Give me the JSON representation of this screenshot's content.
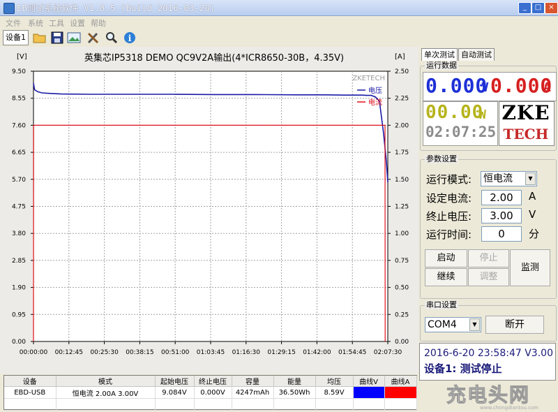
{
  "window": {
    "title": "EB测试系统软件 V1.8.5 (Build 2016-03-20)",
    "minimize": "_",
    "maximize": "□",
    "close": "×"
  },
  "menu": [
    "文件",
    "系统",
    "工具",
    "设置",
    "帮助"
  ],
  "toolbar": {
    "device_tab": "设备1",
    "icons": [
      "folder-open-icon",
      "save-icon",
      "picture-icon",
      "tools-icon",
      "zoom-icon",
      "info-icon"
    ]
  },
  "chart_data": {
    "type": "line",
    "title": "英集芯IP5318 DEMO QC9V2A输出(4*ICR8650-30B，4.35V)",
    "watermark": "ZKETECH",
    "y_left_unit": "[V]",
    "y_right_unit": "[A]",
    "ylim_left": [
      0,
      9.5
    ],
    "ylim_right": [
      0,
      2.5
    ],
    "y_left_ticks": [
      "9.50",
      "8.55",
      "7.60",
      "6.65",
      "5.70",
      "4.75",
      "3.80",
      "2.85",
      "1.90",
      "0.95",
      "0.00"
    ],
    "y_right_ticks": [
      "2.50",
      "2.25",
      "2.00",
      "1.75",
      "1.50",
      "1.25",
      "1.00",
      "0.75",
      "0.50",
      "0.25",
      "0.00"
    ],
    "x_ticks": [
      "00:00:00",
      "00:12:45",
      "00:25:30",
      "00:38:15",
      "00:51:00",
      "01:03:45",
      "01:16:30",
      "01:29:15",
      "01:42:00",
      "01:54:45",
      "02:07:30"
    ],
    "grid": true,
    "legend_position": "top-right",
    "series": [
      {
        "name": "电压",
        "axis": "left",
        "color": "#1a1aa6",
        "x_minutes": [
          0,
          0.4,
          1.5,
          3,
          6,
          10,
          20,
          35,
          50,
          65,
          80,
          95,
          105,
          112,
          118,
          120,
          121.5,
          123,
          124.5,
          126,
          127,
          127.5
        ],
        "values": [
          9.08,
          8.85,
          8.78,
          8.74,
          8.72,
          8.7,
          8.69,
          8.69,
          8.69,
          8.68,
          8.68,
          8.67,
          8.67,
          8.66,
          8.66,
          8.65,
          8.65,
          8.6,
          8.45,
          7.3,
          6.3,
          5.6
        ]
      },
      {
        "name": "电流",
        "axis": "right",
        "color": "#e0101a",
        "x_minutes": [
          0,
          0.05,
          126.5,
          126.55
        ],
        "values": [
          0,
          2.0,
          2.0,
          0
        ]
      }
    ]
  },
  "right_panel": {
    "tabs": [
      "单次测试",
      "自动测试"
    ],
    "run_data_label": "运行数据",
    "voltage": "0.000",
    "voltage_unit": "V",
    "current": "0.000",
    "current_unit": "A",
    "power": "00.00",
    "power_unit": "W",
    "time": "02:07:25",
    "logo_line1": "ZKE",
    "logo_line2": "TECH",
    "params_label": "参数设置",
    "mode_label": "运行模式:",
    "mode_value": "恒电流",
    "set_current_label": "设定电流:",
    "set_current_value": "2.00",
    "set_current_unit": "A",
    "end_voltage_label": "终止电压:",
    "end_voltage_value": "3.00",
    "end_voltage_unit": "V",
    "run_time_label": "运行时间:",
    "run_time_value": "0",
    "run_time_unit": "分",
    "btn_start": "启动",
    "btn_stop": "停止",
    "btn_continue": "继续",
    "btn_adjust": "调整",
    "btn_monitor": "监测",
    "serial_label": "串口设置",
    "com_port": "COM4",
    "btn_disconnect": "断开",
    "status_line1": "2016-6-20 23:58:47 V3.00",
    "status_line2": "设备1: 测试停止"
  },
  "table": {
    "headers": [
      "设备",
      "模式",
      "起始电压",
      "终止电压",
      "容量",
      "能量",
      "均压",
      "曲线V",
      "曲线A"
    ],
    "rows": [
      [
        "EBD-USB",
        "恒电流 2.00A 3.00V",
        "9.084V",
        "0.000V",
        "4247mAh",
        "36.50Wh",
        "8.59V",
        "",
        ""
      ]
    ],
    "curve_colors": [
      "#0000ff",
      "#ff0000"
    ]
  },
  "watermark": {
    "brand": "充电头网",
    "url": "www.chongdiantou.com"
  }
}
